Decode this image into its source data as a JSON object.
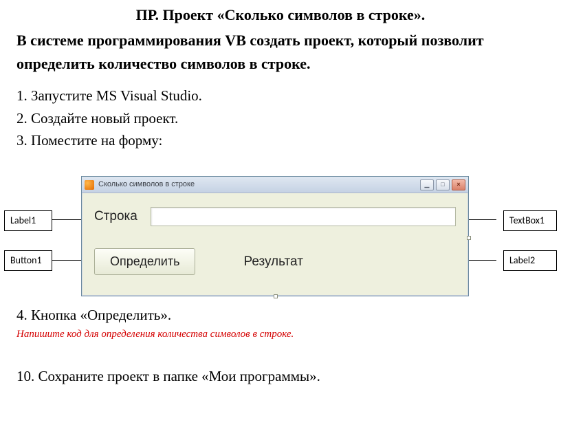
{
  "doc": {
    "title": "ПР. Проект «Сколько символов в строке».",
    "subtitle": "В системе программирования VB создать проект, который позволит определить количество символов в строке.",
    "steps": {
      "s1": "1. Запустите MS Visual Studio.",
      "s2": "2. Создайте новый проект.",
      "s3": "3. Поместите на форму:",
      "s4_prefix": "4. ",
      "s4_text": "Кнопка «Определить».",
      "red_note": "Напишите код для определения количества символов в строке.",
      "s10": "10. Сохраните проект в папке «Мои программы»."
    }
  },
  "callouts": {
    "label1": "Label1",
    "button1": "Button1",
    "textbox1": "TextBox1",
    "label2": "Label2"
  },
  "form": {
    "window_title": "Сколько символов в строке",
    "min_glyph": "▁",
    "max_glyph": "□",
    "close_glyph": "×",
    "label_stroka": "Строка",
    "textbox_value": "",
    "button_label": "Определить",
    "label_result": "Результат"
  }
}
